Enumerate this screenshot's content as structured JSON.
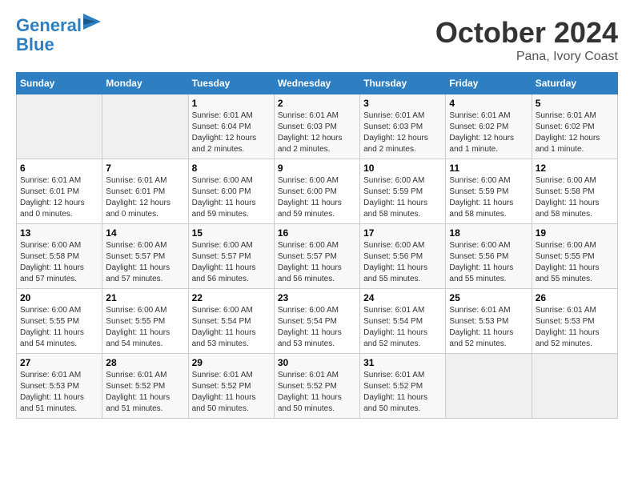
{
  "header": {
    "logo_line1": "General",
    "logo_line2": "Blue",
    "month": "October 2024",
    "location": "Pana, Ivory Coast"
  },
  "days_of_week": [
    "Sunday",
    "Monday",
    "Tuesday",
    "Wednesday",
    "Thursday",
    "Friday",
    "Saturday"
  ],
  "weeks": [
    [
      {
        "day": "",
        "empty": true
      },
      {
        "day": "",
        "empty": true
      },
      {
        "day": "1",
        "sunrise": "Sunrise: 6:01 AM",
        "sunset": "Sunset: 6:04 PM",
        "daylight": "Daylight: 12 hours and 2 minutes."
      },
      {
        "day": "2",
        "sunrise": "Sunrise: 6:01 AM",
        "sunset": "Sunset: 6:03 PM",
        "daylight": "Daylight: 12 hours and 2 minutes."
      },
      {
        "day": "3",
        "sunrise": "Sunrise: 6:01 AM",
        "sunset": "Sunset: 6:03 PM",
        "daylight": "Daylight: 12 hours and 2 minutes."
      },
      {
        "day": "4",
        "sunrise": "Sunrise: 6:01 AM",
        "sunset": "Sunset: 6:02 PM",
        "daylight": "Daylight: 12 hours and 1 minute."
      },
      {
        "day": "5",
        "sunrise": "Sunrise: 6:01 AM",
        "sunset": "Sunset: 6:02 PM",
        "daylight": "Daylight: 12 hours and 1 minute."
      }
    ],
    [
      {
        "day": "6",
        "sunrise": "Sunrise: 6:01 AM",
        "sunset": "Sunset: 6:01 PM",
        "daylight": "Daylight: 12 hours and 0 minutes."
      },
      {
        "day": "7",
        "sunrise": "Sunrise: 6:01 AM",
        "sunset": "Sunset: 6:01 PM",
        "daylight": "Daylight: 12 hours and 0 minutes."
      },
      {
        "day": "8",
        "sunrise": "Sunrise: 6:00 AM",
        "sunset": "Sunset: 6:00 PM",
        "daylight": "Daylight: 11 hours and 59 minutes."
      },
      {
        "day": "9",
        "sunrise": "Sunrise: 6:00 AM",
        "sunset": "Sunset: 6:00 PM",
        "daylight": "Daylight: 11 hours and 59 minutes."
      },
      {
        "day": "10",
        "sunrise": "Sunrise: 6:00 AM",
        "sunset": "Sunset: 5:59 PM",
        "daylight": "Daylight: 11 hours and 58 minutes."
      },
      {
        "day": "11",
        "sunrise": "Sunrise: 6:00 AM",
        "sunset": "Sunset: 5:59 PM",
        "daylight": "Daylight: 11 hours and 58 minutes."
      },
      {
        "day": "12",
        "sunrise": "Sunrise: 6:00 AM",
        "sunset": "Sunset: 5:58 PM",
        "daylight": "Daylight: 11 hours and 58 minutes."
      }
    ],
    [
      {
        "day": "13",
        "sunrise": "Sunrise: 6:00 AM",
        "sunset": "Sunset: 5:58 PM",
        "daylight": "Daylight: 11 hours and 57 minutes."
      },
      {
        "day": "14",
        "sunrise": "Sunrise: 6:00 AM",
        "sunset": "Sunset: 5:57 PM",
        "daylight": "Daylight: 11 hours and 57 minutes."
      },
      {
        "day": "15",
        "sunrise": "Sunrise: 6:00 AM",
        "sunset": "Sunset: 5:57 PM",
        "daylight": "Daylight: 11 hours and 56 minutes."
      },
      {
        "day": "16",
        "sunrise": "Sunrise: 6:00 AM",
        "sunset": "Sunset: 5:57 PM",
        "daylight": "Daylight: 11 hours and 56 minutes."
      },
      {
        "day": "17",
        "sunrise": "Sunrise: 6:00 AM",
        "sunset": "Sunset: 5:56 PM",
        "daylight": "Daylight: 11 hours and 55 minutes."
      },
      {
        "day": "18",
        "sunrise": "Sunrise: 6:00 AM",
        "sunset": "Sunset: 5:56 PM",
        "daylight": "Daylight: 11 hours and 55 minutes."
      },
      {
        "day": "19",
        "sunrise": "Sunrise: 6:00 AM",
        "sunset": "Sunset: 5:55 PM",
        "daylight": "Daylight: 11 hours and 55 minutes."
      }
    ],
    [
      {
        "day": "20",
        "sunrise": "Sunrise: 6:00 AM",
        "sunset": "Sunset: 5:55 PM",
        "daylight": "Daylight: 11 hours and 54 minutes."
      },
      {
        "day": "21",
        "sunrise": "Sunrise: 6:00 AM",
        "sunset": "Sunset: 5:55 PM",
        "daylight": "Daylight: 11 hours and 54 minutes."
      },
      {
        "day": "22",
        "sunrise": "Sunrise: 6:00 AM",
        "sunset": "Sunset: 5:54 PM",
        "daylight": "Daylight: 11 hours and 53 minutes."
      },
      {
        "day": "23",
        "sunrise": "Sunrise: 6:00 AM",
        "sunset": "Sunset: 5:54 PM",
        "daylight": "Daylight: 11 hours and 53 minutes."
      },
      {
        "day": "24",
        "sunrise": "Sunrise: 6:01 AM",
        "sunset": "Sunset: 5:54 PM",
        "daylight": "Daylight: 11 hours and 52 minutes."
      },
      {
        "day": "25",
        "sunrise": "Sunrise: 6:01 AM",
        "sunset": "Sunset: 5:53 PM",
        "daylight": "Daylight: 11 hours and 52 minutes."
      },
      {
        "day": "26",
        "sunrise": "Sunrise: 6:01 AM",
        "sunset": "Sunset: 5:53 PM",
        "daylight": "Daylight: 11 hours and 52 minutes."
      }
    ],
    [
      {
        "day": "27",
        "sunrise": "Sunrise: 6:01 AM",
        "sunset": "Sunset: 5:53 PM",
        "daylight": "Daylight: 11 hours and 51 minutes."
      },
      {
        "day": "28",
        "sunrise": "Sunrise: 6:01 AM",
        "sunset": "Sunset: 5:52 PM",
        "daylight": "Daylight: 11 hours and 51 minutes."
      },
      {
        "day": "29",
        "sunrise": "Sunrise: 6:01 AM",
        "sunset": "Sunset: 5:52 PM",
        "daylight": "Daylight: 11 hours and 50 minutes."
      },
      {
        "day": "30",
        "sunrise": "Sunrise: 6:01 AM",
        "sunset": "Sunset: 5:52 PM",
        "daylight": "Daylight: 11 hours and 50 minutes."
      },
      {
        "day": "31",
        "sunrise": "Sunrise: 6:01 AM",
        "sunset": "Sunset: 5:52 PM",
        "daylight": "Daylight: 11 hours and 50 minutes."
      },
      {
        "day": "",
        "empty": true
      },
      {
        "day": "",
        "empty": true
      }
    ]
  ]
}
